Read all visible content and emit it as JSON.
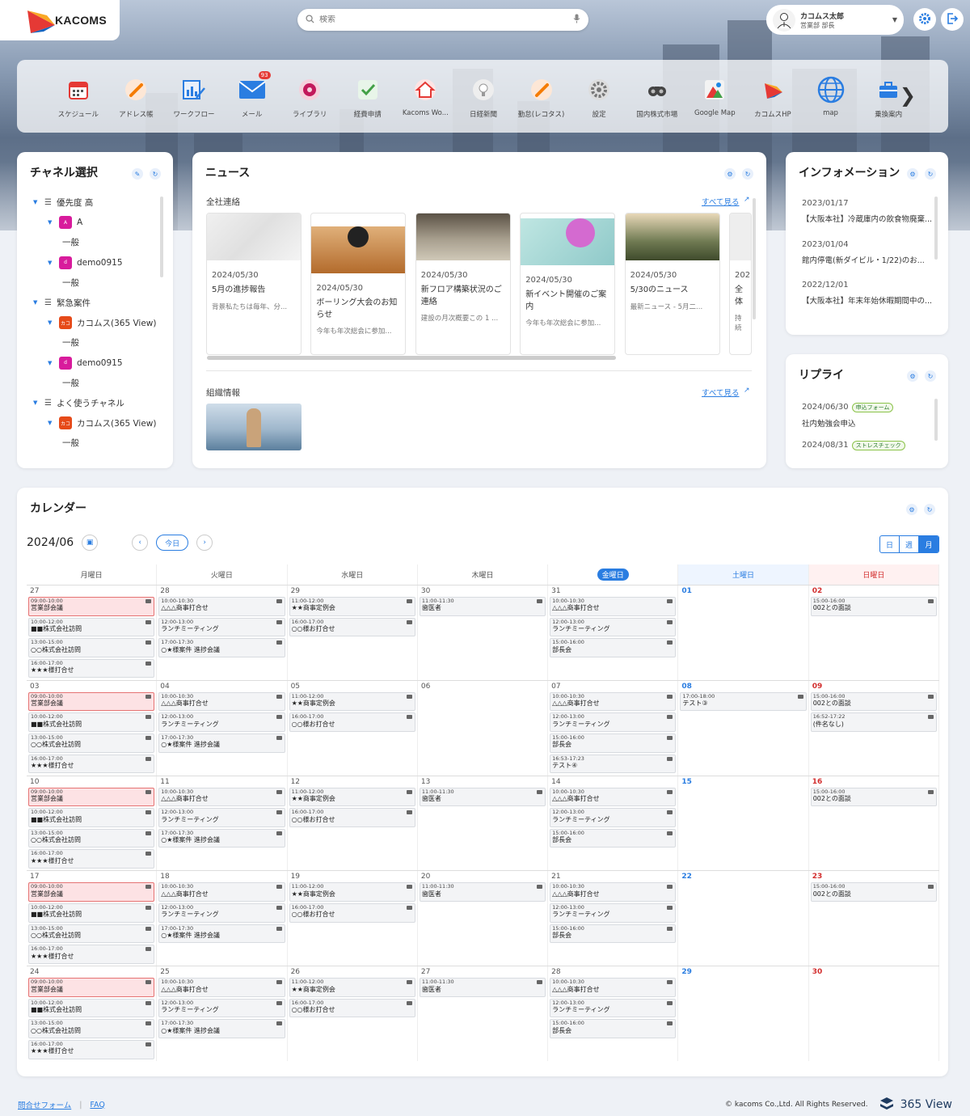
{
  "brand": {
    "name": "KACOMS"
  },
  "search": {
    "placeholder": "検索"
  },
  "user": {
    "name": "カコムス太郎",
    "role": "営業部 部長"
  },
  "apps": [
    {
      "label": "スケジュール",
      "icon": "calendar-icon",
      "color": "#e53935"
    },
    {
      "label": "アドレス帳",
      "icon": "pencil-icon",
      "color": "#f57c00"
    },
    {
      "label": "ワークフロー",
      "icon": "workflow-icon",
      "color": "#2a7de1"
    },
    {
      "label": "メール",
      "icon": "mail-icon",
      "color": "#2a7de1",
      "badge": "93"
    },
    {
      "label": "ライブラリ",
      "icon": "library-icon",
      "color": "#c2185b"
    },
    {
      "label": "経費申請",
      "icon": "check-icon",
      "color": "#43a047"
    },
    {
      "label": "Kacoms Wo...",
      "icon": "home-icon",
      "color": "#e53935"
    },
    {
      "label": "日経新聞",
      "icon": "bulb-icon",
      "color": "#777"
    },
    {
      "label": "勤怠(レコタス)",
      "icon": "pencil-icon",
      "color": "#f57c00"
    },
    {
      "label": "設定",
      "icon": "gear-icon",
      "color": "#777"
    },
    {
      "label": "国内株式市場",
      "icon": "binoculars-icon",
      "color": "#555"
    },
    {
      "label": "Google Map",
      "icon": "map-pin-icon",
      "color": "#e53935"
    },
    {
      "label": "カコムスHP",
      "icon": "kacoms-logo-icon",
      "color": "#f57c00"
    },
    {
      "label": "map",
      "icon": "globe-icon",
      "color": "#2a7de1"
    },
    {
      "label": "乗換案内",
      "icon": "briefcase-icon",
      "color": "#2a7de1"
    }
  ],
  "channel": {
    "title": "チャネル選択",
    "items": [
      {
        "level": 0,
        "label": "優先度 高",
        "type": "list"
      },
      {
        "level": 1,
        "label": "A",
        "type": "chip",
        "chip": "A",
        "color": "#d81b9c"
      },
      {
        "level": 2,
        "label": "一般",
        "type": "text"
      },
      {
        "level": 1,
        "label": "demo0915",
        "type": "chip",
        "chip": "d",
        "color": "#d81b9c"
      },
      {
        "level": 2,
        "label": "一般",
        "type": "text"
      },
      {
        "level": 0,
        "label": "緊急案件",
        "type": "list"
      },
      {
        "level": 1,
        "label": "カコムス(365 View)",
        "type": "chip",
        "chip": "カコ",
        "color": "#e64a19"
      },
      {
        "level": 2,
        "label": "一般",
        "type": "text"
      },
      {
        "level": 1,
        "label": "demo0915",
        "type": "chip",
        "chip": "d",
        "color": "#d81b9c"
      },
      {
        "level": 2,
        "label": "一般",
        "type": "text"
      },
      {
        "level": 0,
        "label": "よく使うチャネル",
        "type": "list"
      },
      {
        "level": 1,
        "label": "カコムス(365 View)",
        "type": "chip",
        "chip": "カコ",
        "color": "#e64a19"
      },
      {
        "level": 2,
        "label": "一般",
        "type": "text"
      }
    ]
  },
  "news": {
    "title": "ニュース",
    "section1": "全社連絡",
    "section2": "組織情報",
    "see_all": "すべて見る",
    "cards": [
      {
        "date": "2024/05/30",
        "title": "5月の進捗報告",
        "summary": "背景私たちは毎年、分...",
        "img": "#e8e8e8"
      },
      {
        "date": "2024/05/30",
        "title": "ボーリング大会のお知らせ",
        "summary": "今年も年次総会に参加...",
        "img": "#c98a4a"
      },
      {
        "date": "2024/05/30",
        "title": "新フロア構築状況のご連絡",
        "summary": "建設の月次概要この 1 ...",
        "img": "#8d8778"
      },
      {
        "date": "2024/05/30",
        "title": "新イベント開催のご案内",
        "summary": "今年も年次総会に参加...",
        "img": "#9fd4d4"
      },
      {
        "date": "2024/05/30",
        "title": "5/30のニュース",
        "summary": "最新ニュース - 5月二...",
        "img": "#6f7a52"
      },
      {
        "date": "202",
        "title": "全体",
        "summary": "持続",
        "img": "#eee"
      }
    ]
  },
  "info": {
    "title": "インフォメーション",
    "items": [
      {
        "date": "2023/01/17",
        "text": "【大阪本社】冷蔵庫内の飲食物廃棄..."
      },
      {
        "date": "2023/01/04",
        "text": "館内停電(新ダイビル・1/22)のお..."
      },
      {
        "date": "2022/12/01",
        "text": "【大阪本社】年末年始休暇期間中の..."
      }
    ]
  },
  "reply": {
    "title": "リプライ",
    "items": [
      {
        "date": "2024/06/30",
        "tag": "申込フォーム",
        "text": "社内勉強会申込"
      },
      {
        "date": "2024/08/31",
        "tag": "ストレスチェック",
        "text": ""
      }
    ]
  },
  "calendar": {
    "title": "カレンダー",
    "month": "2024/06",
    "today_label": "今日",
    "views": [
      "日",
      "週",
      "月"
    ],
    "dow": [
      "月曜日",
      "火曜日",
      "水曜日",
      "木曜日",
      "金曜日",
      "土曜日",
      "日曜日"
    ],
    "weeks": [
      {
        "days": [
          {
            "n": "27",
            "ev": [
              [
                "09:00-10:00",
                "営業部会議",
                1
              ],
              [
                "10:00-12:00",
                "■■株式会社訪問"
              ],
              [
                "13:00-15:00",
                "○○株式会社訪問"
              ],
              [
                "16:00-17:00",
                "★★★様打合せ"
              ]
            ]
          },
          {
            "n": "28",
            "ev": [
              [
                "10:00-10:30",
                "△△△商事打合せ"
              ],
              [
                "12:00-13:00",
                "ランチミーティング"
              ],
              [
                "17:00-17:30",
                "○★様案件 進捗会議"
              ]
            ]
          },
          {
            "n": "29",
            "ev": [
              [
                "11:00-12:00",
                "★★商事定例会"
              ],
              [
                "16:00-17:00",
                "○○様お打合せ"
              ]
            ]
          },
          {
            "n": "30",
            "ev": [
              [
                "11:00-11:30",
                "歯医者"
              ]
            ]
          },
          {
            "n": "31",
            "ev": [
              [
                "10:00-10:30",
                "△△△商事打合せ"
              ],
              [
                "12:00-13:00",
                "ランチミーティング"
              ],
              [
                "15:00-16:00",
                "部長会"
              ]
            ]
          },
          {
            "n": "01",
            "ev": []
          },
          {
            "n": "02",
            "ev": [
              [
                "15:00-16:00",
                "002との面談"
              ]
            ]
          }
        ]
      },
      {
        "days": [
          {
            "n": "03",
            "ev": [
              [
                "09:00-10:00",
                "営業部会議",
                1
              ],
              [
                "10:00-12:00",
                "■■株式会社訪問"
              ],
              [
                "13:00-15:00",
                "○○株式会社訪問"
              ],
              [
                "16:00-17:00",
                "★★★様打合せ"
              ]
            ]
          },
          {
            "n": "04",
            "ev": [
              [
                "10:00-10:30",
                "△△△商事打合せ"
              ],
              [
                "12:00-13:00",
                "ランチミーティング"
              ],
              [
                "17:00-17:30",
                "○★様案件 進捗会議"
              ]
            ]
          },
          {
            "n": "05",
            "ev": [
              [
                "11:00-12:00",
                "★★商事定例会"
              ],
              [
                "16:00-17:00",
                "○○様お打合せ"
              ]
            ]
          },
          {
            "n": "06",
            "ev": []
          },
          {
            "n": "07",
            "ev": [
              [
                "10:00-10:30",
                "△△△商事打合せ"
              ],
              [
                "12:00-13:00",
                "ランチミーティング"
              ],
              [
                "15:00-16:00",
                "部長会"
              ],
              [
                "16:53-17:23",
                "テスト④"
              ]
            ]
          },
          {
            "n": "08",
            "ev": [
              [
                "17:00-18:00",
                "テスト③"
              ]
            ]
          },
          {
            "n": "09",
            "ev": [
              [
                "15:00-16:00",
                "002との面談"
              ],
              [
                "16:52-17:22",
                "(件名なし)"
              ]
            ]
          }
        ]
      },
      {
        "days": [
          {
            "n": "10",
            "ev": [
              [
                "09:00-10:00",
                "営業部会議",
                1
              ],
              [
                "10:00-12:00",
                "■■株式会社訪問"
              ],
              [
                "13:00-15:00",
                "○○株式会社訪問"
              ],
              [
                "16:00-17:00",
                "★★★様打合せ"
              ]
            ]
          },
          {
            "n": "11",
            "ev": [
              [
                "10:00-10:30",
                "△△△商事打合せ"
              ],
              [
                "12:00-13:00",
                "ランチミーティング"
              ],
              [
                "17:00-17:30",
                "○★様案件 進捗会議"
              ]
            ]
          },
          {
            "n": "12",
            "ev": [
              [
                "11:00-12:00",
                "★★商事定例会"
              ],
              [
                "16:00-17:00",
                "○○様お打合せ"
              ]
            ]
          },
          {
            "n": "13",
            "ev": [
              [
                "11:00-11:30",
                "歯医者"
              ]
            ]
          },
          {
            "n": "14",
            "ev": [
              [
                "10:00-10:30",
                "△△△商事打合せ"
              ],
              [
                "12:00-13:00",
                "ランチミーティング"
              ],
              [
                "15:00-16:00",
                "部長会"
              ]
            ]
          },
          {
            "n": "15",
            "ev": []
          },
          {
            "n": "16",
            "ev": [
              [
                "15:00-16:00",
                "002との面談"
              ]
            ]
          }
        ]
      },
      {
        "days": [
          {
            "n": "17",
            "ev": [
              [
                "09:00-10:00",
                "営業部会議",
                1
              ],
              [
                "10:00-12:00",
                "■■株式会社訪問"
              ],
              [
                "13:00-15:00",
                "○○株式会社訪問"
              ],
              [
                "16:00-17:00",
                "★★★様打合せ"
              ]
            ]
          },
          {
            "n": "18",
            "ev": [
              [
                "10:00-10:30",
                "△△△商事打合せ"
              ],
              [
                "12:00-13:00",
                "ランチミーティング"
              ],
              [
                "17:00-17:30",
                "○★様案件 進捗会議"
              ]
            ]
          },
          {
            "n": "19",
            "ev": [
              [
                "11:00-12:00",
                "★★商事定例会"
              ],
              [
                "16:00-17:00",
                "○○様お打合せ"
              ]
            ]
          },
          {
            "n": "20",
            "ev": [
              [
                "11:00-11:30",
                "歯医者"
              ]
            ]
          },
          {
            "n": "21",
            "ev": [
              [
                "10:00-10:30",
                "△△△商事打合せ"
              ],
              [
                "12:00-13:00",
                "ランチミーティング"
              ],
              [
                "15:00-16:00",
                "部長会"
              ]
            ]
          },
          {
            "n": "22",
            "ev": []
          },
          {
            "n": "23",
            "ev": [
              [
                "15:00-16:00",
                "002との面談"
              ]
            ]
          }
        ]
      },
      {
        "days": [
          {
            "n": "24",
            "ev": [
              [
                "09:00-10:00",
                "営業部会議",
                1
              ],
              [
                "10:00-12:00",
                "■■株式会社訪問"
              ],
              [
                "13:00-15:00",
                "○○株式会社訪問"
              ],
              [
                "16:00-17:00",
                "★★★様打合せ"
              ]
            ]
          },
          {
            "n": "25",
            "ev": [
              [
                "10:00-10:30",
                "△△△商事打合せ"
              ],
              [
                "12:00-13:00",
                "ランチミーティング"
              ],
              [
                "17:00-17:30",
                "○★様案件 進捗会議"
              ]
            ]
          },
          {
            "n": "26",
            "ev": [
              [
                "11:00-12:00",
                "★★商事定例会"
              ],
              [
                "16:00-17:00",
                "○○様お打合せ"
              ]
            ]
          },
          {
            "n": "27",
            "ev": [
              [
                "11:00-11:30",
                "歯医者"
              ]
            ]
          },
          {
            "n": "28",
            "ev": [
              [
                "10:00-10:30",
                "△△△商事打合せ"
              ],
              [
                "12:00-13:00",
                "ランチミーティング"
              ],
              [
                "15:00-16:00",
                "部長会"
              ]
            ]
          },
          {
            "n": "29",
            "ev": []
          },
          {
            "n": "30",
            "ev": []
          }
        ]
      }
    ]
  },
  "footer": {
    "contact": "問合せフォーム",
    "faq": "FAQ",
    "copyright": "© kacoms Co.,Ltd. All Rights Reserved.",
    "product": "365 View"
  }
}
